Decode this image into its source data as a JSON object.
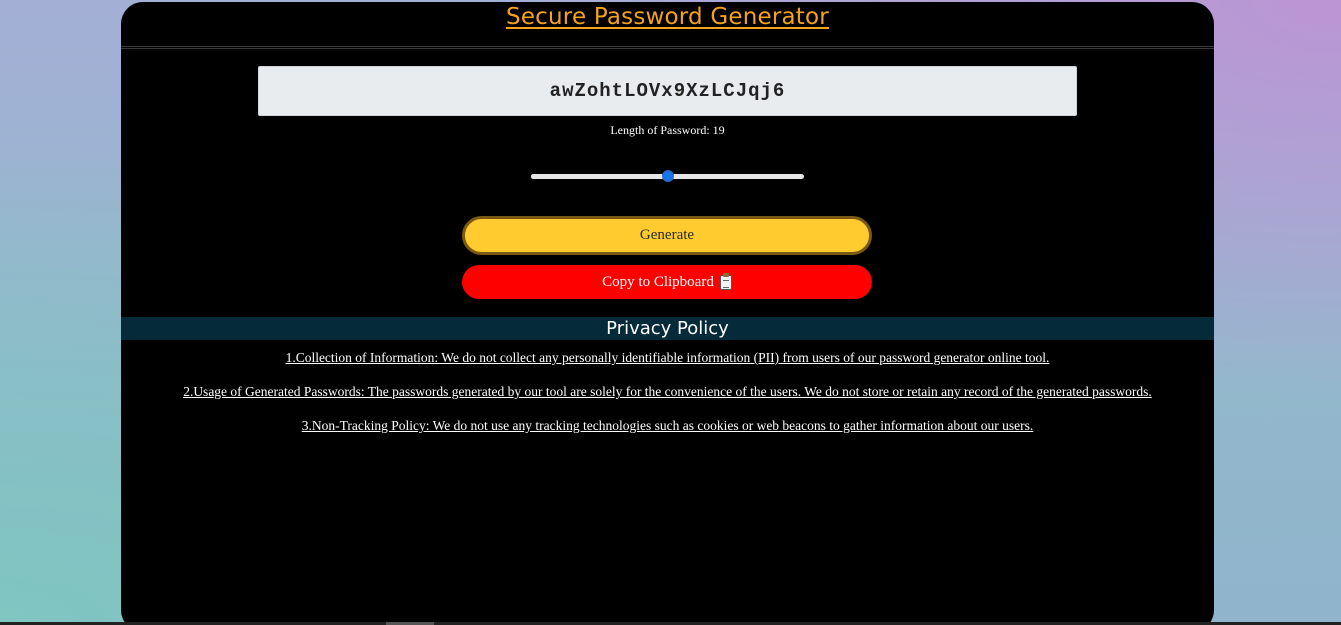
{
  "app": {
    "title": "Secure Password Generator"
  },
  "generator": {
    "password": "awZohtLOVx9XzLCJqj6",
    "length_label": "Length of Password: 19",
    "length_value": 19,
    "length_min": 8,
    "length_max": 30,
    "generate_label": "Generate",
    "copy_label": "Copy to Clipboard",
    "copy_icon": "clipboard-icon"
  },
  "privacy": {
    "heading": "Privacy Policy",
    "items": [
      "1.Collection of Information: We do not collect any personally identifiable information (PII) from users of our password generator online tool.",
      "2.Usage of Generated Passwords: The passwords generated by our tool are solely for the convenience of the users. We do not store or retain any record of the generated passwords.",
      "3.Non-Tracking Policy: We do not use any tracking technologies such as cookies or web beacons to gather information about our users."
    ]
  },
  "colors": {
    "title": "#f5a31a",
    "generate_button": "#ffcb2e",
    "copy_button": "#ff0000",
    "privacy_header_bg": "#052a3a",
    "slider_thumb": "#1a73e8"
  }
}
